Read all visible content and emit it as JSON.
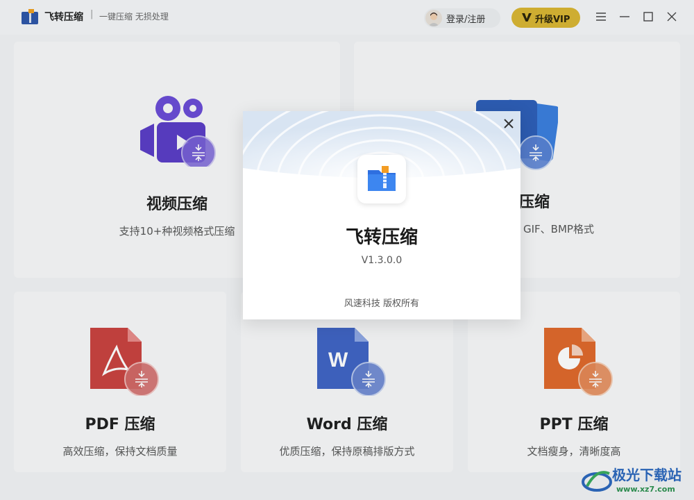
{
  "header": {
    "app_name": "飞转压缩",
    "separator": "|",
    "slogan": "一键压缩 无损处理",
    "login_label": "登录/注册",
    "vip_label": "升级VIP",
    "vip_color": "#d9b531"
  },
  "cards": {
    "video": {
      "title": "视频压缩",
      "desc": "支持10+种视频格式压缩",
      "icon": "video-camera-icon"
    },
    "image": {
      "title": "压缩",
      "desc": "GIF、BMP格式",
      "icon": "image-icon"
    },
    "pdf": {
      "title": "PDF 压缩",
      "desc": "高效压缩，保持文档质量",
      "icon": "pdf-file-icon"
    },
    "word": {
      "title": "Word 压缩",
      "desc": "优质压缩，保持原稿排版方式",
      "icon": "word-file-icon"
    },
    "ppt": {
      "title": "PPT 压缩",
      "desc": "文档瘦身，清晰度高",
      "icon": "ppt-file-icon"
    }
  },
  "about_dialog": {
    "title": "飞转压缩",
    "version": "V1.3.0.0",
    "copyright": "风速科技 版权所有"
  },
  "watermark": {
    "text": "极光下载站",
    "url": "www.xz7.com"
  }
}
